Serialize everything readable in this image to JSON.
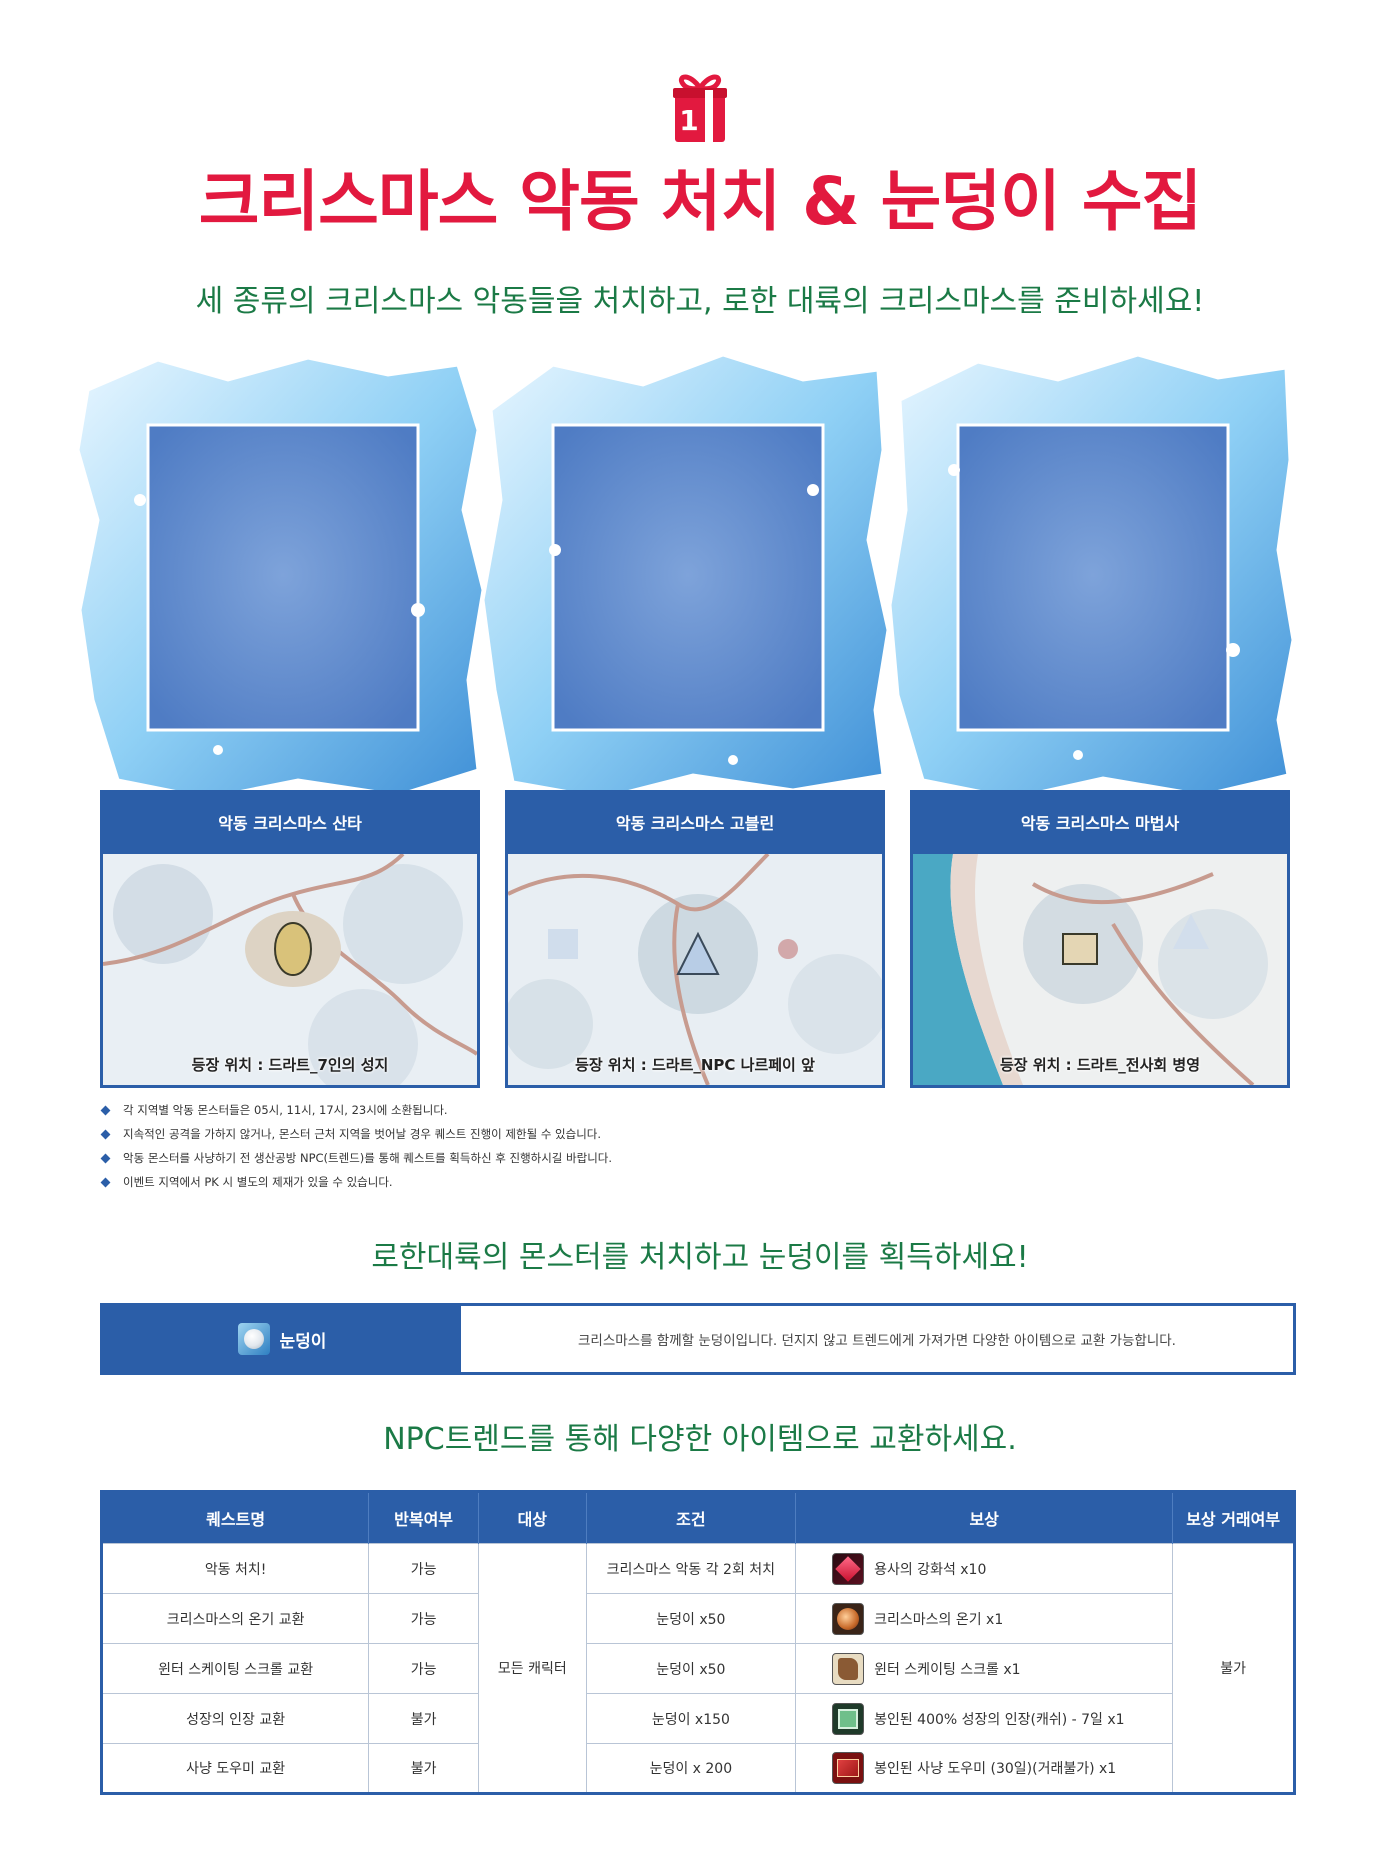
{
  "header": {
    "gift_number": "1",
    "title": "크리스마스 악동 처치 & 눈덩이 수집",
    "subtitle": "세 종류의 크리스마스 악동들을 처치하고, 로한 대륙의 크리스마스를 준비하세요!"
  },
  "monsters": [
    {
      "name": "악동 크리스마스 산타",
      "location": "등장 위치 : 드라트_7인의 성지"
    },
    {
      "name": "악동 크리스마스 고블린",
      "location": "등장 위치 : 드라트_NPC 나르페이 앞"
    },
    {
      "name": "악동 크리스마스 마법사",
      "location": "등장 위치 : 드라트_전사회 병영"
    }
  ],
  "notes": [
    "각 지역별 악동 몬스터들은 05시, 11시, 17시, 23시에 소환됩니다.",
    "지속적인 공격을 가하지 않거나, 몬스터 근처 지역을 벗어날 경우 퀘스트 진행이 제한될 수 있습니다.",
    "악동 몬스터를 사냥하기 전 생산공방 NPC(트렌드)를 통해 퀘스트를 획득하신 후 진행하시길 바랍니다.",
    "이벤트 지역에서 PK 시 별도의 제재가 있을 수 있습니다."
  ],
  "snowball_section": {
    "title": "로한대륙의 몬스터를 처치하고 눈덩이를 획득하세요!",
    "item_name": "눈덩이",
    "item_desc": "크리스마스를 함께할 눈덩이입니다. 던지지 않고 트렌드에게 가져가면 다양한 아이템으로 교환 가능합니다."
  },
  "exchange_section": {
    "title": "NPC트렌드를 통해 다양한 아이템으로 교환하세요.",
    "headers": [
      "퀘스트명",
      "반복여부",
      "대상",
      "조건",
      "보상",
      "보상 거래여부"
    ],
    "target": "모든 캐릭터",
    "tradeable": "불가",
    "rows": [
      {
        "quest": "악동 처치!",
        "repeat": "가능",
        "condition": "크리스마스 악동 각 2회 처치",
        "reward": "용사의 강화석 x10",
        "icon": "gem-icon"
      },
      {
        "quest": "크리스마스의 온기 교환",
        "repeat": "가능",
        "condition": "눈덩이 x50",
        "reward": "크리스마스의 온기 x1",
        "icon": "orb-icon"
      },
      {
        "quest": "윈터 스케이팅 스크롤 교환",
        "repeat": "가능",
        "condition": "눈덩이 x50",
        "reward": "윈터 스케이팅 스크롤 x1",
        "icon": "scroll-icon"
      },
      {
        "quest": "성장의 인장 교환",
        "repeat": "불가",
        "condition": "눈덩이 x150",
        "reward": "봉인된 400% 성장의 인장(캐쉬) - 7일 x1",
        "icon": "seal-book-icon"
      },
      {
        "quest": "사냥 도우미 교환",
        "repeat": "불가",
        "condition": "눈덩이 x 200",
        "reward": "봉인된 사냥 도우미 (30일)(거래불가) x1",
        "icon": "helper-book-icon"
      }
    ]
  },
  "colors": {
    "title_red": "#e2193f",
    "subtitle_green": "#1b7a46",
    "panel_blue": "#2b5ea8"
  }
}
